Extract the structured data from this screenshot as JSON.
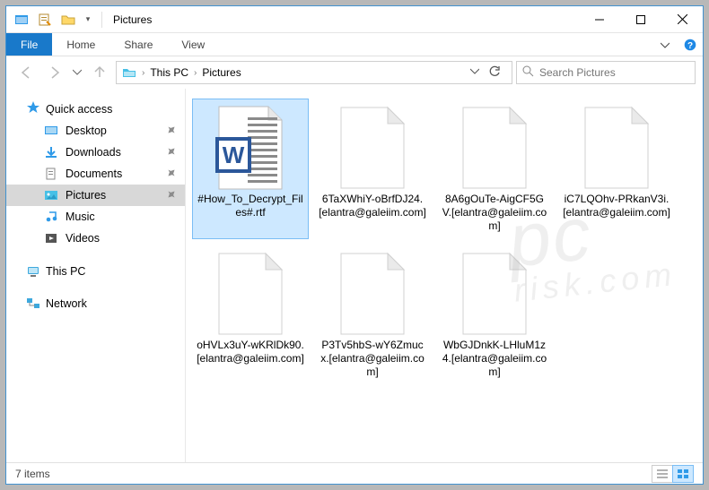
{
  "window": {
    "title": "Pictures"
  },
  "ribbon": {
    "file": "File",
    "tabs": [
      "Home",
      "Share",
      "View"
    ]
  },
  "breadcrumb": {
    "root": "This PC",
    "current": "Pictures"
  },
  "search": {
    "placeholder": "Search Pictures"
  },
  "nav": {
    "quick_access": "Quick access",
    "items": [
      {
        "label": "Desktop",
        "icon": "desktop",
        "pinned": true
      },
      {
        "label": "Downloads",
        "icon": "downloads",
        "pinned": true
      },
      {
        "label": "Documents",
        "icon": "documents",
        "pinned": true
      },
      {
        "label": "Pictures",
        "icon": "pictures",
        "pinned": true,
        "selected": true
      },
      {
        "label": "Music",
        "icon": "music",
        "pinned": false
      },
      {
        "label": "Videos",
        "icon": "videos",
        "pinned": false
      }
    ],
    "this_pc": "This PC",
    "network": "Network"
  },
  "files": [
    {
      "name": "#How_To_Decrypt_Files#.rtf",
      "type": "rtf",
      "selected": true
    },
    {
      "name": "6TaXWhiY-oBrfDJ24.[elantra@galeiim.com]",
      "type": "unknown"
    },
    {
      "name": "8A6gOuTe-AigCF5GV.[elantra@galeiim.com]",
      "type": "unknown"
    },
    {
      "name": "iC7LQOhv-PRkanV3i.[elantra@galeiim.com]",
      "type": "unknown"
    },
    {
      "name": "oHVLx3uY-wKRlDk90.[elantra@galeiim.com]",
      "type": "unknown"
    },
    {
      "name": "P3Tv5hbS-wY6Zmucx.[elantra@galeiim.com]",
      "type": "unknown"
    },
    {
      "name": "WbGJDnkK-LHluM1z4.[elantra@galeiim.com]",
      "type": "unknown"
    }
  ],
  "status": {
    "count_label": "7 items"
  }
}
